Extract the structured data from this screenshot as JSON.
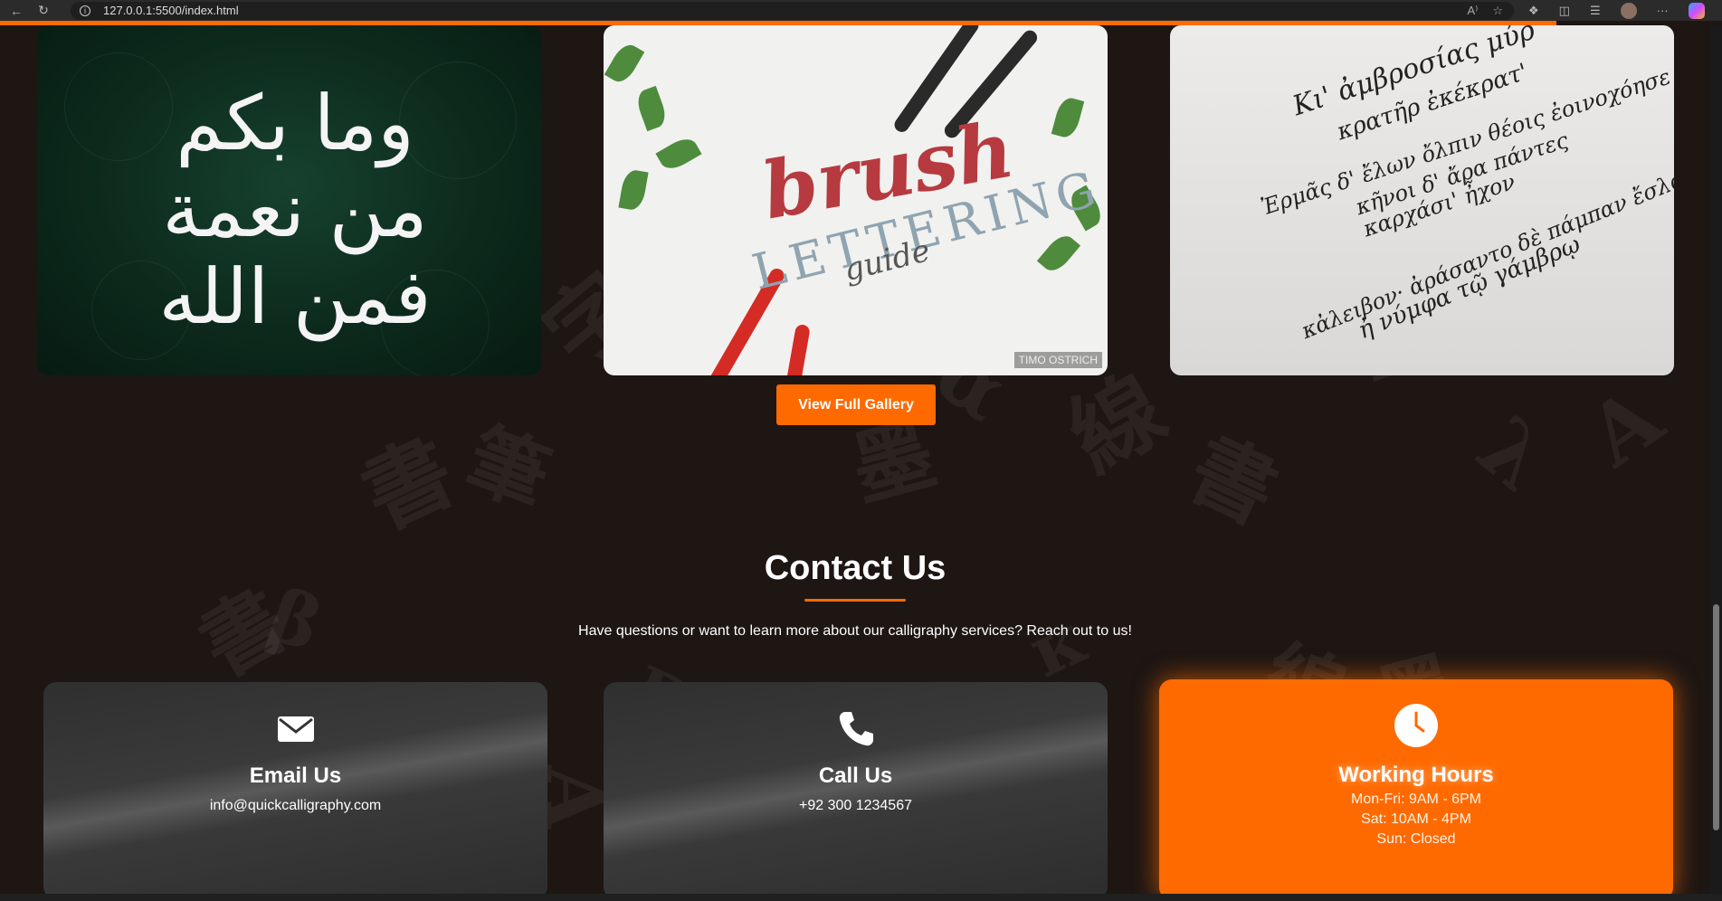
{
  "browser": {
    "url": "127.0.0.1:5500/index.html",
    "back_icon": "arrow-left-icon",
    "reload_icon": "reload-icon",
    "read_aloud_label": "A⁾",
    "more_label": "···"
  },
  "gallery": {
    "images": [
      {
        "name": "arabic-calligraphy-image",
        "caption_text": "وما بكم من نعمة فمن الله"
      },
      {
        "name": "brush-lettering-image",
        "brush": "brush",
        "lettering": "LETTERING",
        "guide": "guide",
        "credit": "TIMO OSTRICH"
      },
      {
        "name": "greek-calligraphy-image",
        "lines": [
          "Κι' ἀμβροσίας μύρ",
          "κρατῆρ ἐκέκρατ'",
          "Ἐρμᾶς δ' ἔλων ὄλπιν θέοις ἐοινοχόησε",
          "κῆνοι δ' ἄρα πάντες",
          "καρχάσι' ἦχον",
          "κἀλειβον· ἀράσαντο δὲ πάμπαν ἔσλα",
          "ἠ νύμφα τῷ γάμβρῳ"
        ]
      }
    ],
    "button_label": "View Full Gallery"
  },
  "contact": {
    "title": "Contact Us",
    "subtitle": "Have questions or want to learn more about our calligraphy services? Reach out to us!",
    "cards": [
      {
        "title": "Email Us",
        "icon": "envelope-icon",
        "lines": [
          "info@quickcalligraphy.com"
        ]
      },
      {
        "title": "Call Us",
        "icon": "phone-icon",
        "lines": [
          "+92 300 1234567"
        ]
      },
      {
        "title": "Working Hours",
        "icon": "clock-icon",
        "lines": [
          "Mon-Fri: 9AM - 6PM",
          "Sat: 10AM - 4PM",
          "Sun: Closed"
        ]
      }
    ]
  },
  "colors": {
    "accent": "#ff6a00",
    "background": "#1d1613",
    "card": "#3a3a3a"
  }
}
